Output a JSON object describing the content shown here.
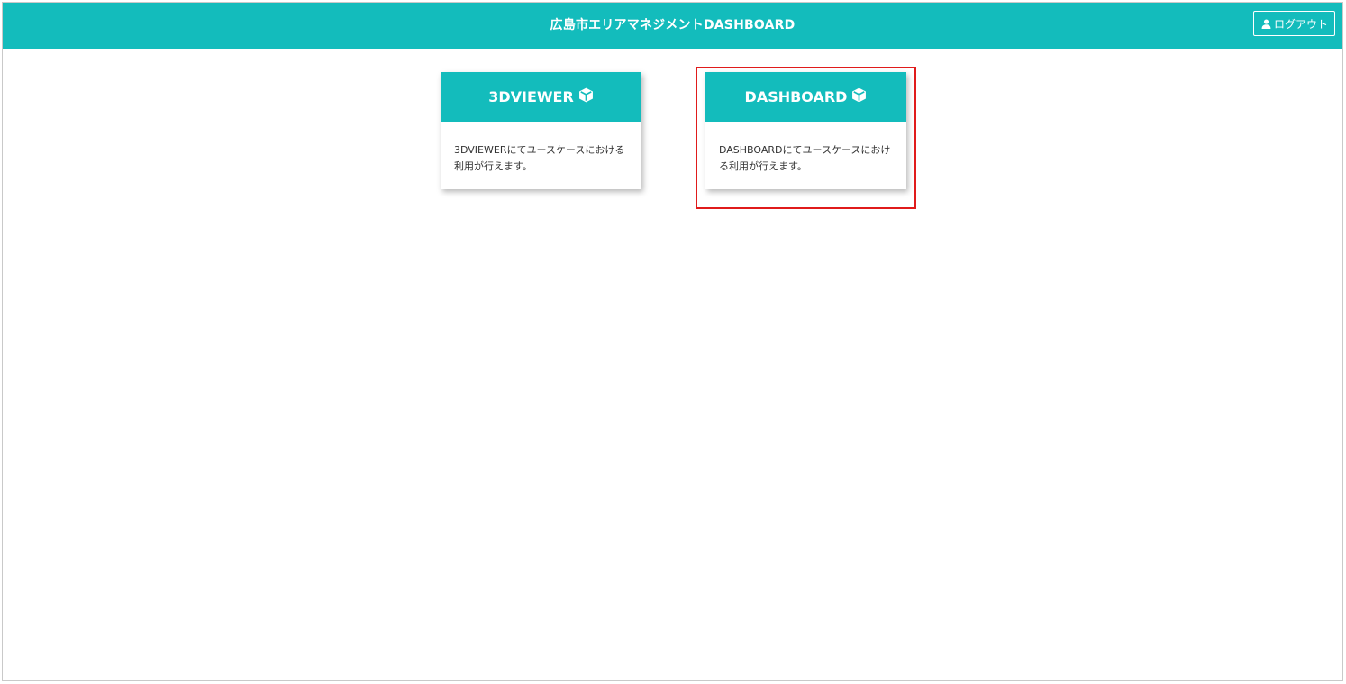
{
  "header": {
    "title": "広島市エリアマネジメントDASHBOARD",
    "logout_label": "ログアウト",
    "background_color": "#13bcbc",
    "logout_icon": "user-icon"
  },
  "cards": [
    {
      "title": "3DVIEWER",
      "icon": "cube-icon",
      "description": "3DVIEWERにてユースケースにおける利用が行えます。"
    },
    {
      "title": "DASHBOARD",
      "icon": "cube-icon",
      "description": "DASHBOARDにてユースケースにおける利用が行えます。"
    }
  ],
  "highlight": {
    "target": "DASHBOARD",
    "color": "#e01b1b"
  }
}
